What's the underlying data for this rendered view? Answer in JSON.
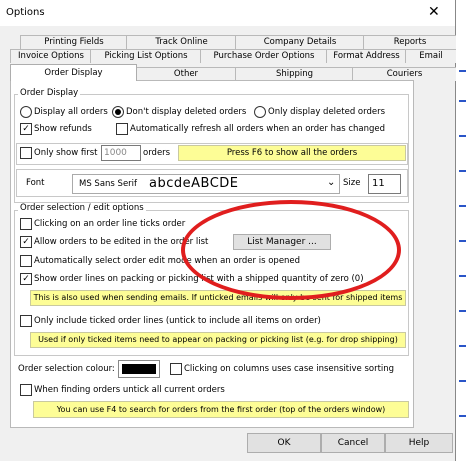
{
  "window": {
    "title": "Options",
    "close_glyph": "✕"
  },
  "tabs_row1": [
    "Printing Fields",
    "Track Online",
    "Company Details",
    "Reports"
  ],
  "tabs_row2": [
    "Invoice Options",
    "Picking List Options",
    "Purchase Order Options",
    "Format Address",
    "Email"
  ],
  "tabs_row3": [
    "Order Display",
    "Other",
    "Shipping",
    "Couriers"
  ],
  "order_display": {
    "legend": "Order Display",
    "radio_display_all": "Display all orders",
    "radio_dont_display_deleted": "Don't display deleted orders",
    "radio_only_deleted": "Only display deleted orders",
    "show_refunds": "Show refunds",
    "auto_refresh": "Automatically refresh all orders when an order has changed",
    "only_show_first": "Only show first",
    "only_show_first_value": "1000",
    "orders_label": "orders",
    "f6_hint": "Press F6 to show all the orders",
    "font_label": "Font",
    "font_name": "MS Sans Serif",
    "font_preview": "abcdeABCDE",
    "size_label": "Size",
    "size_value": "11"
  },
  "order_selection": {
    "legend": "Order selection / edit options",
    "clicking_ticks": "Clicking on an order line ticks order",
    "allow_edit": "Allow orders to be edited in the order list",
    "list_manager_button": "List Manager ...",
    "auto_select": "Automatically select order edit mode when an order is opened",
    "show_lines": "Show order lines on packing or picking list with a shipped quantity of zero (0)",
    "show_lines_note": "This is also used when sending emails. If unticked emails will only be sent for shipped items",
    "only_include_ticked": "Only include ticked order lines (untick to include all items on order)",
    "only_include_note": "Used if only ticked items need to appear on packing or picking list (e.g. for drop shipping)"
  },
  "misc": {
    "selection_colour_label": "Order selection colour:",
    "selection_colour": "#000000",
    "case_insensitive": "Clicking on columns uses case insensitive sorting",
    "untick_current": "When finding orders untick all current orders",
    "f4_hint": "You can use F4 to search for orders from the first order (top of the orders window)"
  },
  "buttons": {
    "ok": "OK",
    "cancel": "Cancel",
    "help": "Help"
  },
  "colors": {
    "highlight_oval": "#e01e1e",
    "note_yellow": "#fdfd96"
  }
}
